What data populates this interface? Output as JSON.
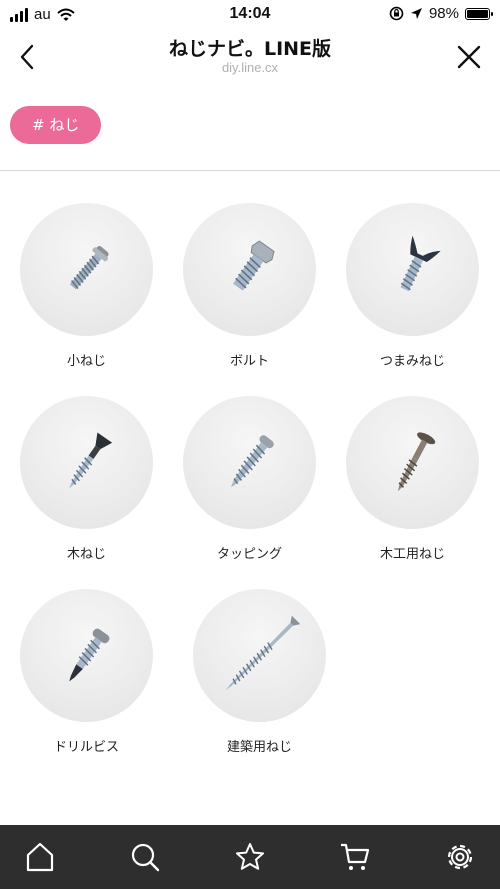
{
  "status_bar": {
    "carrier": "au",
    "time": "14:04",
    "battery": "98%",
    "battery_level": 0.98
  },
  "header": {
    "title": "ねじナビ。LINE版",
    "subtitle": "diy.line.cx",
    "back_icon": "chevron-left-icon",
    "close_icon": "close-icon"
  },
  "tag": {
    "label": "# ねじ",
    "color": "#ec6a97"
  },
  "items": [
    {
      "label": "小ねじ",
      "icon": "small-screw-icon"
    },
    {
      "label": "ボルト",
      "icon": "bolt-icon"
    },
    {
      "label": "つまみねじ",
      "icon": "wing-screw-icon"
    },
    {
      "label": "木ねじ",
      "icon": "wood-screw-icon"
    },
    {
      "label": "タッピング",
      "icon": "tapping-screw-icon"
    },
    {
      "label": "木工用ねじ",
      "icon": "woodworking-screw-icon"
    },
    {
      "label": "ドリルビス",
      "icon": "drill-screw-icon"
    },
    {
      "label": "建築用ねじ",
      "icon": "construction-screw-icon"
    }
  ],
  "tab_bar": {
    "background": "#2e2e2e",
    "tabs": [
      "home-icon",
      "search-icon",
      "star-icon",
      "cart-icon",
      "settings-icon"
    ]
  }
}
